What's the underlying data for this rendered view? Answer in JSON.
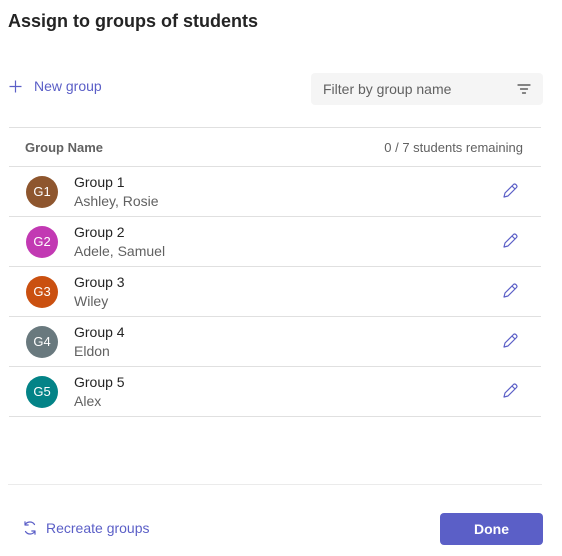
{
  "dialog": {
    "title": "Assign to groups of students"
  },
  "toolbar": {
    "new_group_label": "New group",
    "filter_placeholder": "Filter by group name"
  },
  "table": {
    "header_name": "Group Name",
    "header_remaining": "0 / 7 students remaining",
    "groups": [
      {
        "initials": "G1",
        "name": "Group 1",
        "members": "Ashley, Rosie",
        "color": "#8e562e"
      },
      {
        "initials": "G2",
        "name": "Group 2",
        "members": "Adele, Samuel",
        "color": "#c239b3"
      },
      {
        "initials": "G3",
        "name": "Group 3",
        "members": "Wiley",
        "color": "#ca5010"
      },
      {
        "initials": "G4",
        "name": "Group 4",
        "members": "Eldon",
        "color": "#69797e"
      },
      {
        "initials": "G5",
        "name": "Group 5",
        "members": "Alex",
        "color": "#038387"
      }
    ]
  },
  "footer": {
    "recreate_label": "Recreate groups",
    "done_label": "Done"
  },
  "colors": {
    "accent": "#5b5fc7"
  },
  "icons": {
    "add": "plus-icon",
    "filter": "filter-icon",
    "edit": "pencil-icon",
    "recreate": "refresh-icon"
  }
}
